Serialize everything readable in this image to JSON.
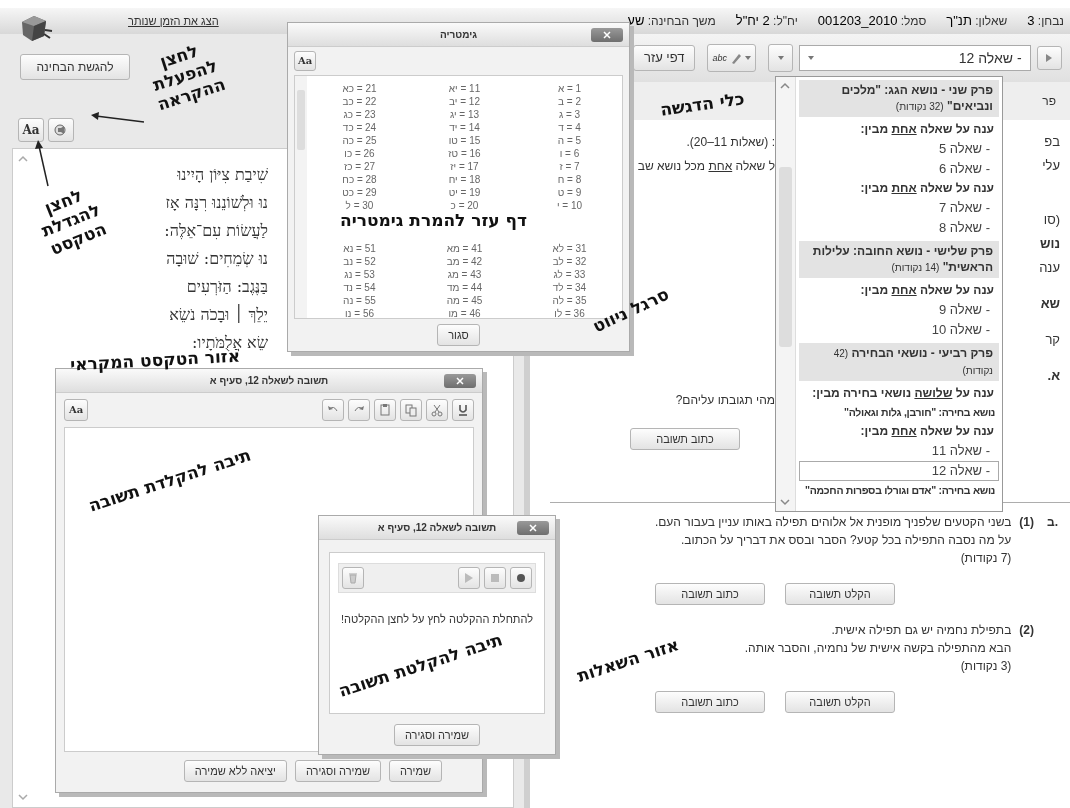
{
  "header": {
    "time_link": "הצג את הזמן שנותר",
    "info": [
      {
        "label": "נבחן:",
        "value": "3"
      },
      {
        "label": "שאלון:",
        "value": "תנ\"ך"
      },
      {
        "label": "סמל:",
        "value": "2010_001203"
      },
      {
        "label": "יח\"ל:",
        "value": "2 יח\"ל"
      },
      {
        "label": "משך הבחינה:",
        "value": "שע"
      }
    ]
  },
  "submit_button": "להגשת הבחינה",
  "text_tools": {
    "font_button": "Aa"
  },
  "bible_text": {
    "lines": [
      "שִׁיבַת צִיּוֹן הָיִינוּ",
      "נוּ וּלְשׁוֹנֵנוּ רִנָּה אָז",
      "לַעֲשׂוֹת עִם־אֵלֶּה:",
      "נוּ שְׂמֵחִים: שׁוּבָה",
      "בַּנֶּגֶב: הַזֹּרְעִים",
      "יֵלֵךְ ׀ וּבָכֹה נֹשֵׂא",
      "שֵׂא אֲלֻמֹּתָיו:"
    ]
  },
  "toolbar": {
    "question_select": "- שאלה 12",
    "helper_button": "דפי עזר",
    "highlighter_label": "abc"
  },
  "question_area": {
    "header_fragment": "פר",
    "rows": [
      {
        "left": [
          {
            "text": ": (שאלות 11–20).",
            "underline": false
          }
        ],
        "right": "בפ"
      },
      {
        "left": [
          {
            "text": "ל שאלה ",
            "underline": false
          },
          {
            "text": "אחת",
            "underline": true
          },
          {
            "text": " מכל נושא שב",
            "underline": false
          }
        ],
        "right": "עלי"
      },
      {
        "left": [],
        "right": "(סו"
      },
      {
        "left": [],
        "right": "נוש"
      },
      {
        "left": [],
        "right": "ענה"
      },
      {
        "left": [],
        "right": "שא"
      },
      {
        "left": [],
        "right": "קר"
      },
      {
        "left": [],
        "right": "א."
      },
      {
        "left": [
          {
            "text": "מהי תגובתו עליהם?",
            "underline": false
          }
        ],
        "right": ""
      }
    ],
    "first_buttons": [
      "כתוב תשובה"
    ],
    "items": [
      {
        "letter": "ב.",
        "number": "(1)",
        "lines": [
          "בשני הקטעים שלפניך מופנית אל אלוהים תפילה באותו עניין בעבור העם.",
          "על מה נסבה התפילה בכל קטע? הסבר ובסס את דבריך על הכתוב.",
          "(7 נקודות)"
        ],
        "buttons": [
          "הקלט תשובה",
          "כתוב תשובה"
        ]
      },
      {
        "number": "(2)",
        "lines": [
          "בתפילת נחמיה יש גם תפילה אישית.",
          "הבא מהתפילה בקשה אישית של נחמיה, והסבר אותה.",
          "(3 נקודות)"
        ],
        "buttons": [
          "הקלט תשובה",
          "כתוב תשובה"
        ]
      }
    ]
  },
  "navigation_menu": {
    "items": [
      {
        "kind": "section",
        "title": "פרק שני - נושא הגג: \"מלכים ונביאים\"",
        "points": "(32 נקודות)"
      },
      {
        "kind": "instruction",
        "parts": [
          {
            "text": "ענה על שאלה ",
            "underline": false
          },
          {
            "text": "אחת",
            "underline": true
          },
          {
            "text": " מבין:",
            "underline": false
          }
        ]
      },
      {
        "kind": "question",
        "label": "- שאלה 5",
        "selected": false
      },
      {
        "kind": "question",
        "label": "- שאלה 6",
        "selected": false
      },
      {
        "kind": "instruction",
        "parts": [
          {
            "text": "ענה על שאלה ",
            "underline": false
          },
          {
            "text": "אחת",
            "underline": true
          },
          {
            "text": " מבין:",
            "underline": false
          }
        ]
      },
      {
        "kind": "question",
        "label": "- שאלה 7",
        "selected": false
      },
      {
        "kind": "question",
        "label": "- שאלה 8",
        "selected": false
      },
      {
        "kind": "section",
        "title": "פרק שלישי - נושא החובה: עלילות הראשית\"",
        "points": "(14 נקודות)"
      },
      {
        "kind": "instruction",
        "parts": [
          {
            "text": "ענה על שאלה ",
            "underline": false
          },
          {
            "text": "אחת",
            "underline": true
          },
          {
            "text": " מבין:",
            "underline": false
          }
        ]
      },
      {
        "kind": "question",
        "label": "- שאלה 9",
        "selected": false
      },
      {
        "kind": "question",
        "label": "- שאלה 10",
        "selected": false
      },
      {
        "kind": "section",
        "title": "פרק רביעי - נושאי הבחירה",
        "points": "(42 נקודות)"
      },
      {
        "kind": "instruction",
        "parts": [
          {
            "text": "ענה על ",
            "underline": false
          },
          {
            "text": "שלושה",
            "underline": true
          },
          {
            "text": " נושאי בחירה מבין:",
            "underline": false
          }
        ]
      },
      {
        "kind": "topic",
        "label": "נושא בחירה: \"חורבן, גלות וגאולה\""
      },
      {
        "kind": "instruction",
        "parts": [
          {
            "text": "ענה על שאלה ",
            "underline": false
          },
          {
            "text": "אחת",
            "underline": true
          },
          {
            "text": " מבין:",
            "underline": false
          }
        ]
      },
      {
        "kind": "question",
        "label": "- שאלה 11",
        "selected": false
      },
      {
        "kind": "question",
        "label": "- שאלה 12",
        "selected": true
      },
      {
        "kind": "topic",
        "label": "נושא בחירה: \"אדם וגורלו בספרות החכמה\""
      }
    ]
  },
  "gematria_window": {
    "title": "גימטריה",
    "font_button": "Aa",
    "close_button": "סגור",
    "blocks": [
      {
        "columns": [
          [
            "1 = א",
            "2 = ב",
            "3 = ג",
            "4 = ד",
            "5 = ה",
            "6 = ו",
            "7 = ז",
            "8 = ח",
            "9 = ט",
            "10 = י"
          ],
          [
            "11 = יא",
            "12 = יב",
            "13 = יג",
            "14 = יד",
            "15 = טו",
            "16 = טז",
            "17 = יז",
            "18 = יח",
            "19 = יט",
            "20 = כ"
          ],
          [
            "21 = כא",
            "22 = כב",
            "23 = כג",
            "24 = כד",
            "25 = כה",
            "26 = כו",
            "27 = כז",
            "28 = כח",
            "29 = כט",
            "30 = ל"
          ]
        ]
      },
      {
        "columns": [
          [
            "31 = לא",
            "32 = לב",
            "33 = לג",
            "34 = לד",
            "35 = לה",
            "36 = לו"
          ],
          [
            "41 = מא",
            "42 = מב",
            "43 = מג",
            "44 = מד",
            "45 = מה",
            "46 = מו"
          ],
          [
            "51 = נא",
            "52 = נב",
            "53 = נג",
            "54 = נד",
            "55 = נה",
            "56 = נו"
          ]
        ]
      }
    ]
  },
  "answer_window": {
    "title": "תשובה לשאלה 12, סעיף א",
    "font_button": "Aa",
    "buttons": [
      "שמירה",
      "שמירה וסגירה",
      "יציאה ללא שמירה"
    ]
  },
  "record_window": {
    "title": "תשובה לשאלה 12, סעיף א",
    "message": "להתחלת ההקלטה לחץ על לחצן ההקלטה!",
    "button": "שמירה וסגירה"
  },
  "annotations": [
    {
      "text": "לחצן להפעלת ההקראה"
    },
    {
      "text": "לחצן להגדלת הטקסט"
    },
    {
      "text": "אזור הטקסט המקראי"
    },
    {
      "text": "דף עזר להמרת גימטריה"
    },
    {
      "text": "כלי הדגשה"
    },
    {
      "text": "סרגל ניווט"
    },
    {
      "text": "תיבה להקלדת תשובה"
    },
    {
      "text": "תיבה להקלטת תשובה"
    },
    {
      "text": "אזור השאלות"
    }
  ]
}
